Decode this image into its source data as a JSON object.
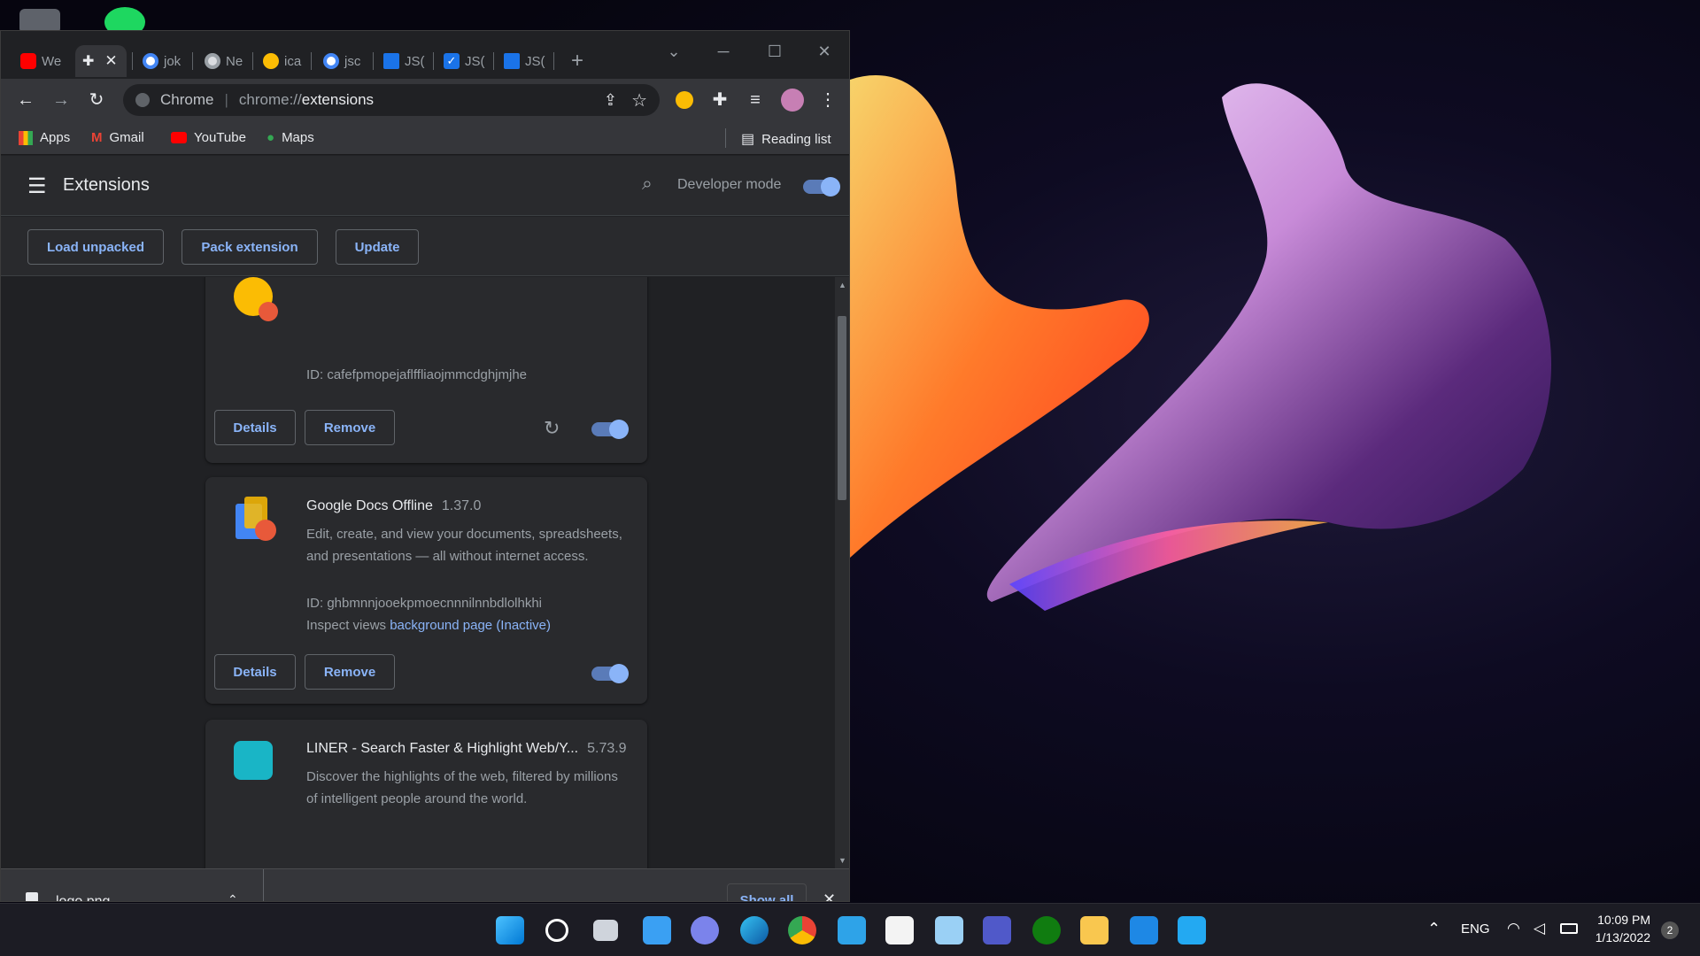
{
  "browser": {
    "tabs": [
      {
        "title": "We",
        "favicon": "youtube-icon",
        "color": "#ff0000"
      },
      {
        "title": "",
        "favicon": "puzzle-icon",
        "color": "#e8eaed"
      },
      {
        "title": "jok",
        "favicon": "google-icon",
        "color": "#4285f4"
      },
      {
        "title": "Ne",
        "favicon": "chrome-icon",
        "color": "#dadce0"
      },
      {
        "title": "ica",
        "favicon": "emoji-icon",
        "color": "#fbbc04"
      },
      {
        "title": "jsc",
        "favicon": "google-icon",
        "color": "#4285f4"
      },
      {
        "title": "JS(",
        "favicon": "json-icon",
        "color": "#1a73e8"
      },
      {
        "title": "JS(",
        "favicon": "checkbox-icon",
        "color": "#1a73e8"
      },
      {
        "title": "JS(",
        "favicon": "json-icon",
        "color": "#1a73e8"
      }
    ],
    "new_tab_symbol": "+",
    "omnibox": {
      "site_label": "Chrome",
      "url_prefix": "chrome://",
      "url_path": "extensions"
    },
    "bookmarks": [
      "Apps",
      "Gmail",
      "YouTube",
      "Maps"
    ],
    "reading_list": "Reading list"
  },
  "extensions_page": {
    "title": "Extensions",
    "developer_mode_label": "Developer mode",
    "developer_mode_on": true,
    "buttons": {
      "load_unpacked": "Load unpacked",
      "pack_extension": "Pack extension",
      "update": "Update"
    },
    "cards": [
      {
        "title": "",
        "version": "",
        "id_line": "ID: cafefpmopejaflffliaojmmcdghjmjhe",
        "details_label": "Details",
        "remove_label": "Remove",
        "enabled": true
      },
      {
        "title": "Google Docs Offline",
        "version": "1.37.0",
        "description": "Edit, create, and view your documents, spreadsheets, and presentations — all without internet access.",
        "id_line": "ID: ghbmnnjooekpmoecnnnilnnbdlolhkhi",
        "inspect_label": "Inspect views",
        "inspect_link": "background page (Inactive)",
        "details_label": "Details",
        "remove_label": "Remove",
        "enabled": true
      },
      {
        "title": "LINER - Search Faster & Highlight Web/Y...",
        "version": "5.73.9",
        "description": "Discover the highlights of the web, filtered by millions of intelligent people around the world."
      }
    ]
  },
  "download_shelf": {
    "file_name": "logo.png",
    "show_all_label": "Show all"
  },
  "taskbar": {
    "apps": [
      "windows-start-icon",
      "search-icon",
      "task-view-icon",
      "widgets-icon",
      "chat-icon",
      "edge-icon",
      "chrome-icon",
      "remote-desktop-icon",
      "store-icon",
      "photos-icon",
      "teams-icon",
      "xbox-icon",
      "file-explorer-icon",
      "mail-icon",
      "vscode-icon"
    ],
    "language": "ENG",
    "time": "10:09 PM",
    "date": "1/13/2022",
    "notification_count": "2"
  }
}
